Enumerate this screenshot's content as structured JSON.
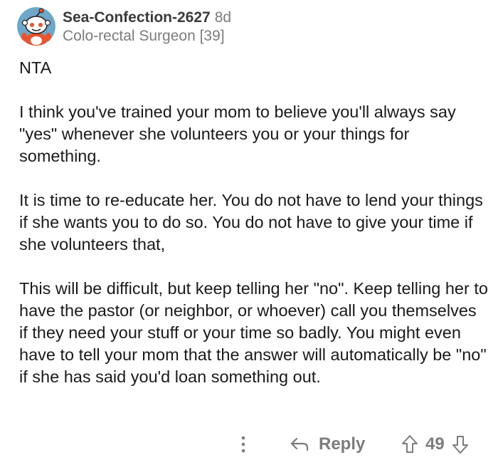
{
  "comment": {
    "author": {
      "username": "Sea-Confection-2627",
      "age": "8d",
      "flair": "Colo-rectal Surgeon [39]",
      "avatar_icon": "snoo-avatar-icon"
    },
    "paragraphs": [
      "NTA",
      "I think you've trained your mom to believe you'll always say \"yes\" whenever she volunteers you or your things for something.",
      "It is time to re-educate her. You do not have to lend your things if she wants you to do so. You do not have to give your time if she volunteers that,",
      "This will be difficult, but keep telling her \"no\". Keep telling her to have the pastor (or neighbor, or whoever) call you themselves if they need your stuff or your time so badly. You might even have to tell your mom that the answer will automatically be \"no\" if she has said you'd loan something out."
    ],
    "actions": {
      "more_icon": "more-vertical-icon",
      "reply_icon": "reply-arrow-icon",
      "reply_label": "Reply",
      "upvote_icon": "upvote-arrow-icon",
      "score": "49",
      "downvote_icon": "downvote-arrow-icon"
    }
  },
  "colors": {
    "text": "#1a1a1b",
    "muted": "#7c7c7c",
    "username": "#3a3a3c",
    "background": "#ffffff"
  }
}
